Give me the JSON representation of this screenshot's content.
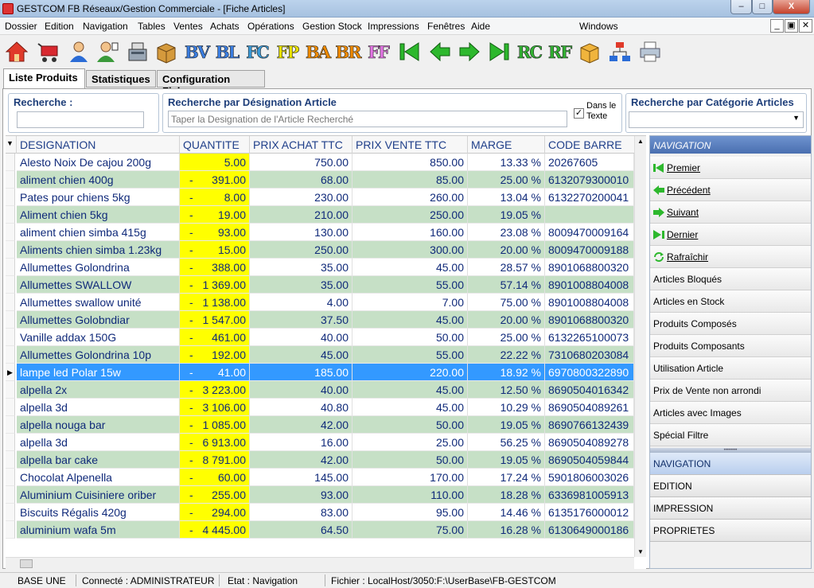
{
  "window": {
    "title": "GESTCOM FB Réseaux/Gestion Commerciale - [Fiche Articles]",
    "min_label": "–",
    "max_label": "□",
    "close_label": "X",
    "windows_menu": "Windows"
  },
  "menu": [
    "Dossier",
    "Edition",
    "Navigation",
    "Tables",
    "Ventes",
    "Achats",
    "Opérations",
    "Gestion Stock",
    "Impressions",
    "Fenêtres",
    "Aide"
  ],
  "mdi": {
    "min": "_",
    "restore": "▣",
    "close": "✕"
  },
  "toolbar": {
    "text_buttons": [
      {
        "label": "BV",
        "color": "#3a7de0"
      },
      {
        "label": "BL",
        "color": "#3a7de0"
      },
      {
        "label": "FC",
        "color": "#3a9ad8"
      },
      {
        "label": "FP",
        "color": "#e8e000"
      },
      {
        "label": "BA",
        "color": "#f08a00"
      },
      {
        "label": "BR",
        "color": "#f08a00"
      },
      {
        "label": "FF",
        "color": "#e676e6"
      },
      {
        "label": "RC",
        "color": "#33b233"
      },
      {
        "label": "RF",
        "color": "#33b233"
      }
    ]
  },
  "tabs": [
    "Liste Produits",
    "Statistiques",
    "Configuration Fiche"
  ],
  "search": {
    "recherche_label": "Recherche :",
    "designation_label": "Recherche par Désignation Article",
    "designation_placeholder": "Taper la Designation de l'Article Recherché",
    "dans_le_texte": "Dans le Texte",
    "dans_le_texte_checked": true,
    "categorie_label": "Recherche par Catégorie Articles"
  },
  "grid": {
    "headers": [
      "DESIGNATION",
      "QUANTITE",
      "PRIX ACHAT TTC",
      "PRIX VENTE TTC",
      "MARGE",
      "CODE BARRE"
    ],
    "selected_index": 12,
    "rows": [
      {
        "designation": "Alesto Noix De cajou 200g",
        "neg": false,
        "quantite": "5.00",
        "achat": "750.00",
        "vente": "850.00",
        "marge": "13.33 %",
        "code": "20267605"
      },
      {
        "designation": "aliment chien 400g",
        "neg": true,
        "quantite": "391.00",
        "achat": "68.00",
        "vente": "85.00",
        "marge": "25.00 %",
        "code": "6132079300010"
      },
      {
        "designation": "Pates pour chiens 5kg",
        "neg": true,
        "quantite": "8.00",
        "achat": "230.00",
        "vente": "260.00",
        "marge": "13.04 %",
        "code": "6132270200041"
      },
      {
        "designation": "Aliment chien 5kg",
        "neg": true,
        "quantite": "19.00",
        "achat": "210.00",
        "vente": "250.00",
        "marge": "19.05 %",
        "code": ""
      },
      {
        "designation": "aliment chien simba 415g",
        "neg": true,
        "quantite": "93.00",
        "achat": "130.00",
        "vente": "160.00",
        "marge": "23.08 %",
        "code": "8009470009164"
      },
      {
        "designation": "Aliments chien simba 1.23kg",
        "neg": true,
        "quantite": "15.00",
        "achat": "250.00",
        "vente": "300.00",
        "marge": "20.00 %",
        "code": "8009470009188"
      },
      {
        "designation": "Allumettes Golondrina",
        "neg": true,
        "quantite": "388.00",
        "achat": "35.00",
        "vente": "45.00",
        "marge": "28.57 %",
        "code": "8901068800320"
      },
      {
        "designation": "Allumettes SWALLOW",
        "neg": true,
        "quantite": "1 369.00",
        "achat": "35.00",
        "vente": "55.00",
        "marge": "57.14 %",
        "code": "8901008804008"
      },
      {
        "designation": "Allumettes swallow unité",
        "neg": true,
        "quantite": "1 138.00",
        "achat": "4.00",
        "vente": "7.00",
        "marge": "75.00 %",
        "code": "8901008804008"
      },
      {
        "designation": "Allumettes Golobndiar",
        "neg": true,
        "quantite": "1 547.00",
        "achat": "37.50",
        "vente": "45.00",
        "marge": "20.00 %",
        "code": "8901068800320"
      },
      {
        "designation": "Vanille addax 150G",
        "neg": true,
        "quantite": "461.00",
        "achat": "40.00",
        "vente": "50.00",
        "marge": "25.00 %",
        "code": "6132265100073"
      },
      {
        "designation": "Allumettes Golondrina 10p",
        "neg": true,
        "quantite": "192.00",
        "achat": "45.00",
        "vente": "55.00",
        "marge": "22.22 %",
        "code": "7310680203084"
      },
      {
        "designation": "lampe led Polar 15w",
        "neg": true,
        "quantite": "41.00",
        "achat": "185.00",
        "vente": "220.00",
        "marge": "18.92 %",
        "code": "6970800322890"
      },
      {
        "designation": "alpella 2x",
        "neg": true,
        "quantite": "3 223.00",
        "achat": "40.00",
        "vente": "45.00",
        "marge": "12.50 %",
        "code": "8690504016342"
      },
      {
        "designation": "alpella 3d",
        "neg": true,
        "quantite": "3 106.00",
        "achat": "40.80",
        "vente": "45.00",
        "marge": "10.29 %",
        "code": "8690504089261"
      },
      {
        "designation": "alpella nouga bar",
        "neg": true,
        "quantite": "1 085.00",
        "achat": "42.00",
        "vente": "50.00",
        "marge": "19.05 %",
        "code": "8690766132439"
      },
      {
        "designation": "alpella 3d",
        "neg": true,
        "quantite": "6 913.00",
        "achat": "16.00",
        "vente": "25.00",
        "marge": "56.25 %",
        "code": "8690504089278"
      },
      {
        "designation": "alpella bar cake",
        "neg": true,
        "quantite": "8 791.00",
        "achat": "42.00",
        "vente": "50.00",
        "marge": "19.05 %",
        "code": "8690504059844"
      },
      {
        "designation": "Chocolat Alpenella",
        "neg": true,
        "quantite": "60.00",
        "achat": "145.00",
        "vente": "170.00",
        "marge": "17.24 %",
        "code": "5901806003026"
      },
      {
        "designation": "Aluminium Cuisiniere oriber",
        "neg": true,
        "quantite": "255.00",
        "achat": "93.00",
        "vente": "110.00",
        "marge": "18.28 %",
        "code": "6336981005913"
      },
      {
        "designation": "Biscuits Régalis 420g",
        "neg": true,
        "quantite": "294.00",
        "achat": "83.00",
        "vente": "95.00",
        "marge": "14.46 %",
        "code": "6135176000012"
      },
      {
        "designation": "aluminium wafa 5m",
        "neg": true,
        "quantite": "4 445.00",
        "achat": "64.50",
        "vente": "75.00",
        "marge": "16.28 %",
        "code": "6130649000186"
      }
    ]
  },
  "sidebar": {
    "header": "NAVIGATION",
    "nav_items": [
      {
        "label": "Premier",
        "icon": "first-icon"
      },
      {
        "label": "Précédent",
        "icon": "prev-icon"
      },
      {
        "label": "Suivant",
        "icon": "next-icon"
      },
      {
        "label": "Dernier",
        "icon": "last-icon"
      },
      {
        "label": "Rafraîchir",
        "icon": "refresh-icon"
      }
    ],
    "filters": [
      "Articles Bloqués",
      "Articles en Stock",
      "Produits Composés",
      "Produits Composants",
      "Utilisation Article",
      "Prix de Vente non arrondi",
      "Articles avec Images",
      "Spécial Filtre"
    ],
    "splitter": "••••••••",
    "sections": [
      "NAVIGATION",
      "EDITION",
      "IMPRESSION",
      "PROPRIETES"
    ]
  },
  "status": {
    "base": "BASE UNE",
    "connecte": "Connecté : ADMINISTRATEUR",
    "etat": "Etat : Navigation",
    "fichier": "Fichier : LocalHost/3050:F:\\UserBase\\FB-GESTCOM"
  }
}
